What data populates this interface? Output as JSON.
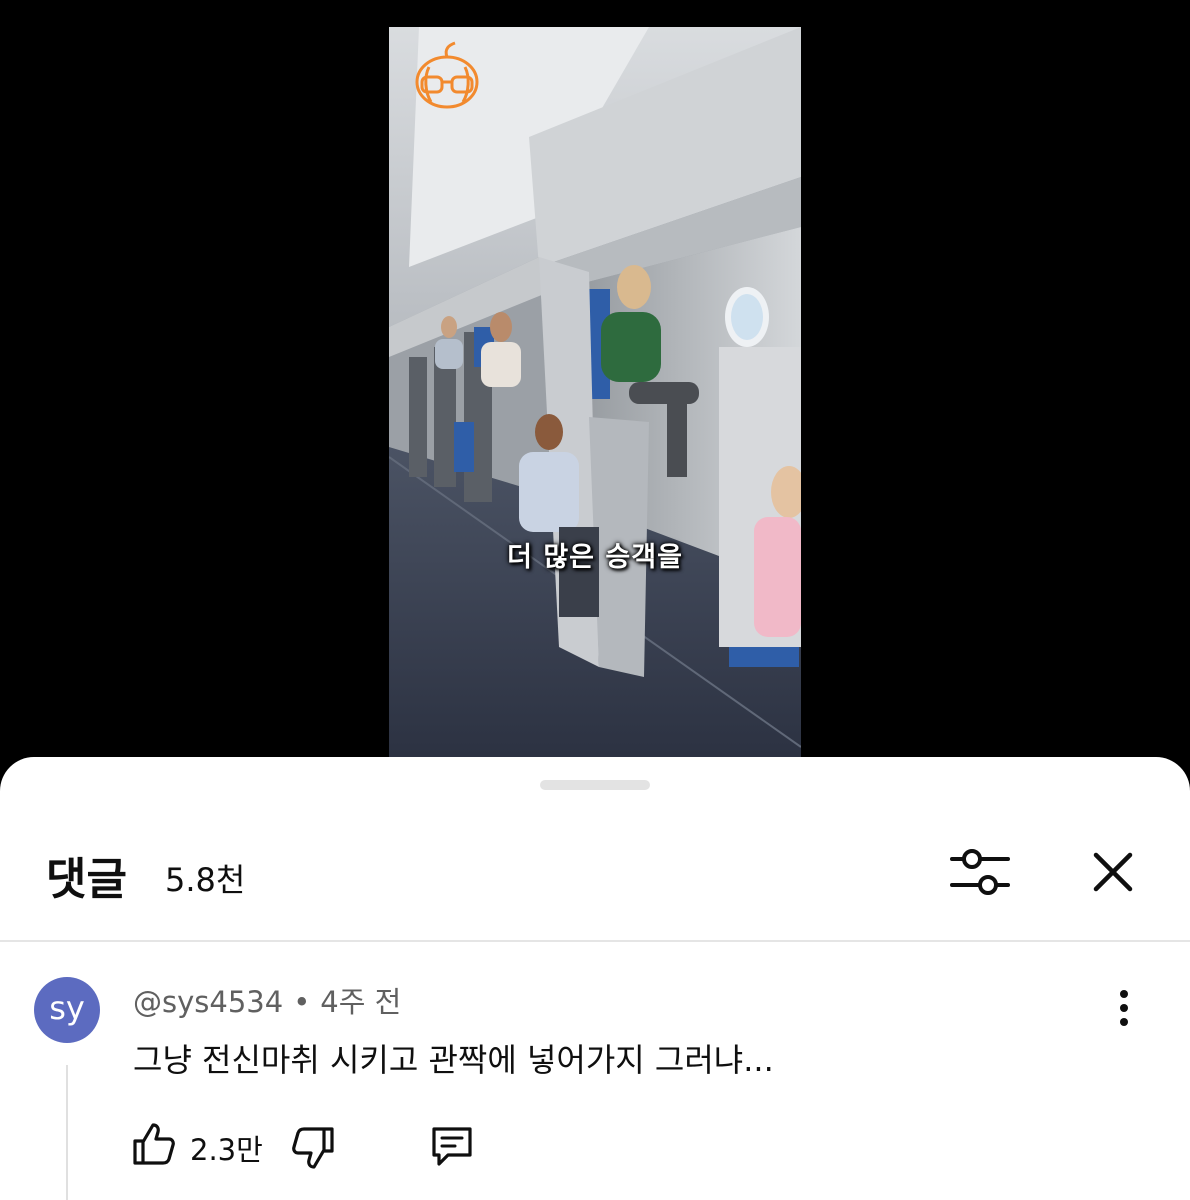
{
  "video": {
    "caption": "더 많은 승객을"
  },
  "comments_panel": {
    "title": "댓글",
    "count": "5.8천",
    "icons": {
      "filter": "sliders-icon",
      "close": "close-icon"
    }
  },
  "comments": [
    {
      "avatar_initials": "sy",
      "avatar_color": "#5c6bc0",
      "author": "@sys4534",
      "separator": "•",
      "time": "4주 전",
      "text": "그냥 전신마취 시키고 관짝에 넣어가지 그러냐...",
      "likes": "2.3만",
      "icons": {
        "like": "thumbs-up-icon",
        "dislike": "thumbs-down-icon",
        "reply": "reply-icon",
        "more": "more-vertical-icon"
      }
    }
  ]
}
